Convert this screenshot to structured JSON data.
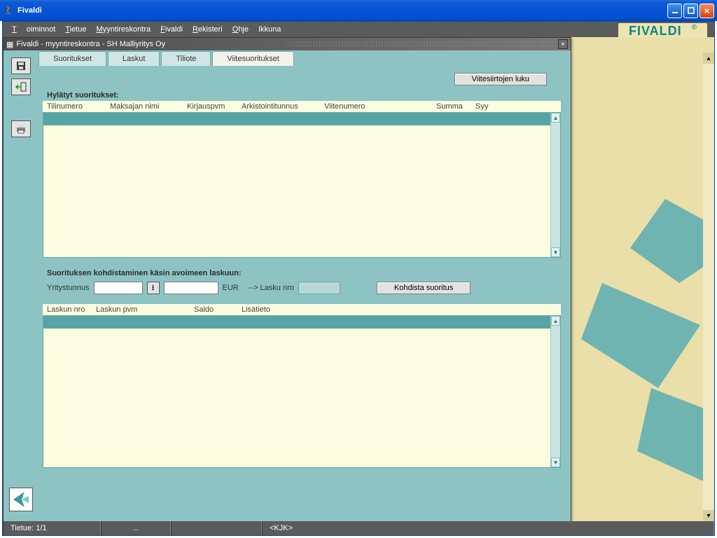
{
  "window": {
    "title": "Fivaldi"
  },
  "brand": "FIVALDI",
  "menu": {
    "toiminnot": "Toiminnot",
    "tietue": "Tietue",
    "myyntireskontra": "Myyntireskontra",
    "fivaldi": "Fivaldi",
    "rekisteri": "Rekisteri",
    "ohje": "Ohje",
    "ikkuna": "Ikkuna"
  },
  "inner": {
    "title": "Fivaldi - myyntireskontra - SH Malliyritys Oy"
  },
  "tabs": {
    "suoritukset": "Suoritukset",
    "laskut": "Laskut",
    "tiliote": "Tiliote",
    "viitesuoritukset": "Viitesuoritukset"
  },
  "buttons": {
    "viitesiirtojen_luku": "Viitesiirtojen luku",
    "kohdista": "Kohdista suoritus"
  },
  "labels": {
    "hylatyt": "Hylätyt suoritukset:",
    "kohdistaminen": "Suorituksen kohdistaminen käsin avoimeen laskuun:",
    "yritystunnus": "Yritystunnus",
    "eur": "EUR",
    "lasku_arrow": "-->  Lasku nro"
  },
  "cols1": {
    "tilinumero": "Tilinumero",
    "maksajan_nimi": "Maksajan nimi",
    "kirjauspvm": "Kirjauspvm",
    "arkistointitunnus": "Arkistointitunnus",
    "viitenumero": "Viitenumero",
    "summa": "Summa",
    "syy": "Syy"
  },
  "cols2": {
    "laskun_nro": "Laskun nro",
    "laskun_pvm": "Laskun pvm",
    "saldo": "Saldo",
    "lisatieto": "Lisätieto"
  },
  "form": {
    "yritystunnus_value": "",
    "amount_value": "",
    "lasku_nro_value": ""
  },
  "status": {
    "tietue": "Tietue: 1/1",
    "dots": "...",
    "user": "<KJK>"
  }
}
